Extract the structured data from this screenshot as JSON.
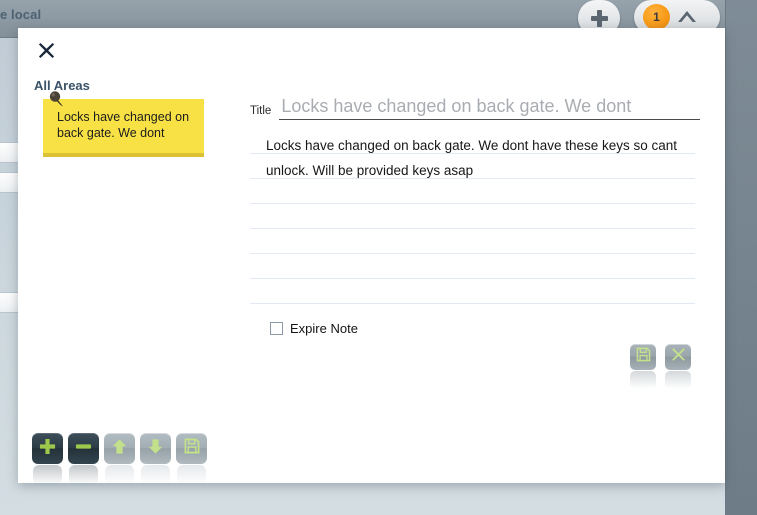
{
  "background": {
    "topbar_title": "e local",
    "add_button_label": "+",
    "notification_count": "1",
    "collapse_icon": "chevron-up-icon"
  },
  "modal": {
    "close_icon": "close-icon",
    "areas": {
      "heading": "All Areas",
      "notes": [
        {
          "pin_icon": "pushpin-icon",
          "text": "Locks have changed on back gate. We dont",
          "color": "#f8e145"
        }
      ]
    },
    "editor": {
      "title_label": "Title",
      "title_value": "Locks have changed on back gate. We dont",
      "title_placeholder": "Title",
      "body_value": "Locks have changed on back gate. We dont have these keys so cant unlock. Will be provided keys asap",
      "body_placeholder": "",
      "expire_label": "Expire Note",
      "expire_checked": false,
      "save_icon": "save-floppy-icon",
      "cancel_icon": "cancel-x-icon"
    },
    "toolbar": {
      "buttons": [
        {
          "name": "add-note-button",
          "icon": "plus-icon",
          "style": "dark"
        },
        {
          "name": "remove-note-button",
          "icon": "minus-icon",
          "style": "dark"
        },
        {
          "name": "move-up-button",
          "icon": "arrow-up-icon",
          "style": "light"
        },
        {
          "name": "move-down-button",
          "icon": "arrow-down-icon",
          "style": "light"
        },
        {
          "name": "save-button",
          "icon": "save-floppy-icon",
          "style": "light"
        }
      ]
    }
  },
  "colors": {
    "note_yellow": "#f8e145",
    "note_yellow_edge": "#ddc135",
    "badge_orange": "#f79a18",
    "heading_blue": "#3b5368",
    "icon_green": "#b5d46a",
    "toolbar_dark": "#2d3c46",
    "toolbar_light": "#a2adb4"
  }
}
